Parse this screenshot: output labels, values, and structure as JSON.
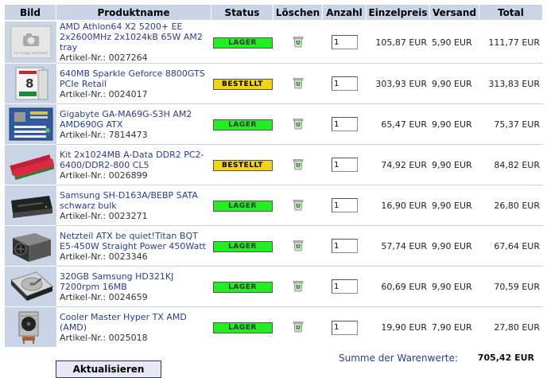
{
  "headers": {
    "image": "Bild",
    "product": "Produktname",
    "status": "Status",
    "delete": "Löschen",
    "quantity": "Anzahl",
    "unit_price": "Einzelpreis",
    "shipping": "Versand",
    "total": "Total"
  },
  "status_colors": {
    "LAGER": "#22ee22",
    "BESTELLT": "#f2d21a"
  },
  "items": [
    {
      "name": "AMD Athlon64 X2 5200+ EE 2x2600MHz 2x1024kB 65W AM2 tray",
      "artnr": "Artikel-Nr.: 0027264",
      "status": "LAGER",
      "qty": "1",
      "unit_price": "105,87 EUR",
      "shipping": "5,90 EUR",
      "total": "111,77 EUR",
      "thumb": "no-image-placeholder"
    },
    {
      "name": "640MB Sparkle Geforce 8800GTS PCIe Retail",
      "artnr": "Artikel-Nr.: 0024017",
      "status": "BESTELLT",
      "qty": "1",
      "unit_price": "303,93 EUR",
      "shipping": "9,90 EUR",
      "total": "313,83 EUR",
      "thumb": "graphics-card-box"
    },
    {
      "name": "Gigabyte GA-MA69G-S3H AM2 AMD690G ATX",
      "artnr": "Artikel-Nr.: 7814473",
      "status": "LAGER",
      "qty": "1",
      "unit_price": "65,47 EUR",
      "shipping": "9,90 EUR",
      "total": "75,37 EUR",
      "thumb": "motherboard"
    },
    {
      "name": "Kit 2x1024MB A-Data DDR2 PC2-6400/DDR2-800 CL5",
      "artnr": "Artikel-Nr.: 0026899",
      "status": "BESTELLT",
      "qty": "1",
      "unit_price": "74,92 EUR",
      "shipping": "9,90 EUR",
      "total": "84,82 EUR",
      "thumb": "ram-modules"
    },
    {
      "name": "Samsung SH-D163A/BEBP SATA schwarz bulk",
      "artnr": "Artikel-Nr.: 0023271",
      "status": "LAGER",
      "qty": "1",
      "unit_price": "16,90 EUR",
      "shipping": "9,90 EUR",
      "total": "26,80 EUR",
      "thumb": "optical-drive"
    },
    {
      "name": "Netzteil ATX be quiet!Titan BQT E5-450W Straight Power 450Watt",
      "artnr": "Artikel-Nr.: 0023346",
      "status": "LAGER",
      "qty": "1",
      "unit_price": "57,74 EUR",
      "shipping": "9,90 EUR",
      "total": "67,64 EUR",
      "thumb": "power-supply"
    },
    {
      "name": "320GB Samsung HD321KJ 7200rpm 16MB",
      "artnr": "Artikel-Nr.: 0024659",
      "status": "LAGER",
      "qty": "1",
      "unit_price": "60,69 EUR",
      "shipping": "9,90 EUR",
      "total": "70,59 EUR",
      "thumb": "hard-drive"
    },
    {
      "name": "Cooler Master Hyper TX AMD (AMD)",
      "artnr": "Artikel-Nr.: 0025018",
      "status": "LAGER",
      "qty": "1",
      "unit_price": "19,90 EUR",
      "shipping": "7,90 EUR",
      "total": "27,80 EUR",
      "thumb": "cpu-cooler"
    }
  ],
  "summary": {
    "label": "Summe der Warenwerte:",
    "value": "705,42 EUR"
  },
  "update_button": "Aktualisieren"
}
